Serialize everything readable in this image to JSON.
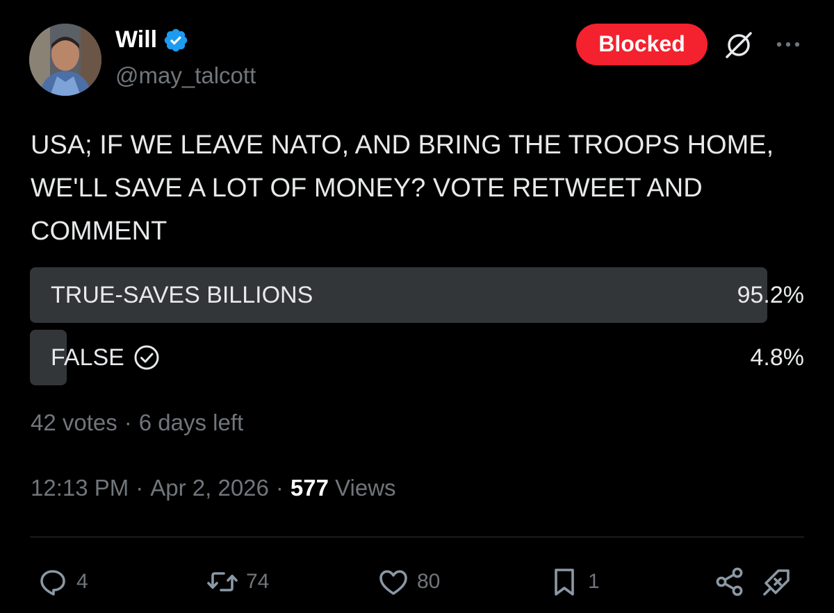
{
  "user": {
    "display_name": "Will",
    "handle": "@may_talcott",
    "verified": true,
    "avatar_icon": "profile-photo"
  },
  "header": {
    "blocked_label": "Blocked",
    "blocked_color": "#f4212e",
    "grok_icon": "grok-icon",
    "more_icon": "more-dots-icon"
  },
  "tweet": {
    "text": "USA; IF WE LEAVE NATO, AND BRING THE TROOPS HOME,\nWE'LL SAVE A LOT OF MONEY? VOTE RETWEET AND\nCOMMENT"
  },
  "poll": {
    "options": [
      {
        "label": "TRUE-SAVES BILLIONS",
        "percent_text": "95.2%",
        "percent": 95.2,
        "voted": false
      },
      {
        "label": "FALSE",
        "percent_text": "4.8%",
        "percent": 4.8,
        "voted": true
      }
    ],
    "votes": "42 votes",
    "time_left": "6 days left",
    "bar_color": "#333639"
  },
  "meta": {
    "time": "12:13 PM",
    "date": "Apr 2, 2026",
    "views_count": "577",
    "views_label": "Views"
  },
  "actions": {
    "replies": "4",
    "retweets": "74",
    "likes": "80",
    "bookmarks": "1"
  },
  "colors": {
    "background": "#000000",
    "text": "#e7e9ea",
    "muted": "#71767b",
    "verified": "#1d9bf0"
  }
}
